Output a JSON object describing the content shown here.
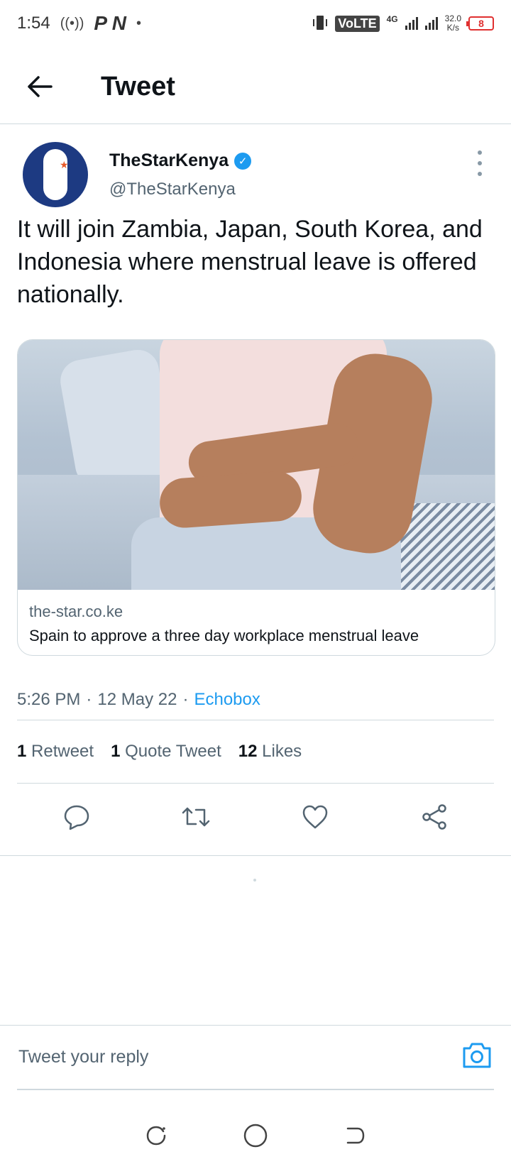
{
  "status_bar": {
    "time": "1:54",
    "radio_glyph": "((•))",
    "app_icons": "P N",
    "dot": "•",
    "network": "VoLTE",
    "network_gen": "4G",
    "speed_value": "32.0",
    "speed_unit": "K/s",
    "battery": "8"
  },
  "header": {
    "title": "Tweet",
    "back_icon": "arrow-left-icon"
  },
  "tweet": {
    "author_name": "TheStarKenya",
    "author_handle": "@TheStarKenya",
    "text": "It will join Zambia, Japan, South Korea, and Indonesia where menstrual leave is offered nationally.",
    "card": {
      "domain": "the-star.co.ke",
      "title": "Spain to approve a three day workplace menstrual leave"
    },
    "time": "5:26 PM",
    "date": "12 May 22",
    "separator": "·",
    "source": "Echobox",
    "stats": {
      "retweets_count": "1",
      "retweets_label": "Retweet",
      "quotes_count": "1",
      "quotes_label": "Quote Tweet",
      "likes_count": "12",
      "likes_label": "Likes"
    }
  },
  "reply": {
    "placeholder": "Tweet your reply"
  },
  "colors": {
    "accent": "#1d9bf0",
    "text": "#0f1419",
    "secondary": "#536471",
    "divider": "#cfd9de"
  }
}
